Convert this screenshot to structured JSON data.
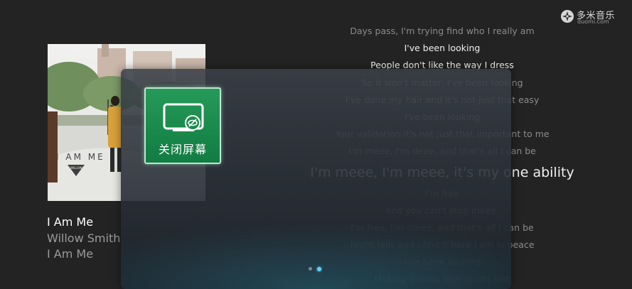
{
  "brand": {
    "name": "多米音乐",
    "domain": "duomi.com",
    "icon": "duomi-logo-icon"
  },
  "song": {
    "title": "I Am Me",
    "artist": "Willow Smith",
    "album": "I Am Me"
  },
  "cover": {
    "caption": "I AM ME",
    "sublabel": "WILLOW"
  },
  "lyrics": {
    "lines": [
      {
        "text": "Days pass, I'm trying find who I really am",
        "style": "faded"
      },
      {
        "text": "I've been looking",
        "style": "normal"
      },
      {
        "text": "People don't like the way I dress",
        "style": "normal"
      },
      {
        "text": "So it won't matter, I've been looking",
        "style": "faded"
      },
      {
        "text": "I've done my hair and it's not just that easy",
        "style": "faded"
      },
      {
        "text": "I've been looking",
        "style": "faded"
      },
      {
        "text": "Your validation it's not just that important to me",
        "style": "faded"
      },
      {
        "text": "I'm meee, I'm deee, and that's all I can be",
        "style": "faded"
      },
      {
        "text": "I'm meee, I'm meee, it's my one ability",
        "style": "current"
      },
      {
        "text": "I'm free",
        "style": "faded"
      },
      {
        "text": "And you can't stop meee,",
        "style": "faded"
      },
      {
        "text": "I'm free, I'm meee, and that's all I can be",
        "style": "faded"
      },
      {
        "text": "Night falls and I find it here I am in peace",
        "style": "faded"
      },
      {
        "text": "I've been looking",
        "style": "faded"
      },
      {
        "text": "Making friends with spirits lost",
        "style": "faded"
      }
    ]
  },
  "menu": {
    "tiles": [
      {
        "label": "关闭屏幕",
        "icon": "screen-off-icon"
      }
    ],
    "pagination": {
      "count": 2,
      "active_index": 1
    }
  },
  "colors": {
    "tile": "#1b8c4e",
    "active_dot": "#5fd3ff",
    "background": "#232323"
  }
}
